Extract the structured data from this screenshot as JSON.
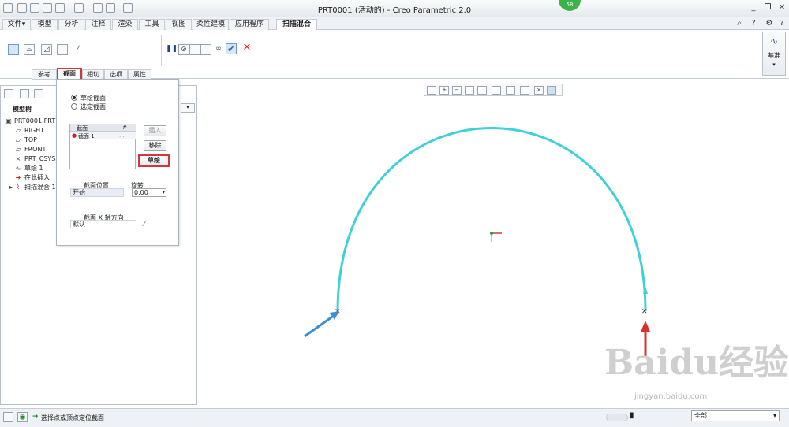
{
  "window": {
    "title": "PRT0001 (活动的) - Creo Parametric 2.0",
    "badge": "58"
  },
  "menu": {
    "tabs": [
      "文件▾",
      "模型",
      "分析",
      "注释",
      "渲染",
      "工具",
      "视图",
      "柔性建模",
      "应用程序"
    ],
    "active_tab": "扫描混合"
  },
  "ribbon": {
    "subtabs": [
      "参考",
      "截面",
      "相切",
      "选项",
      "属性"
    ],
    "active_subtab": "截面",
    "datum_label": "基准"
  },
  "section_panel": {
    "radio_sketched": "草绘截面",
    "radio_selected": "选定截面",
    "table_headers": [
      "截面",
      "#"
    ],
    "table_rows": [
      {
        "name": "截面 1",
        "num": "..."
      }
    ],
    "insert_btn": "插入",
    "remove_btn": "移除",
    "sketch_btn": "草绘",
    "location_label": "截面位置",
    "location_value": "开始",
    "rotation_label": "旋转",
    "rotation_value": "0.00",
    "xaxis_label": "截面 X 轴方向",
    "xaxis_value": "默认"
  },
  "model_tree": {
    "header": "模型树",
    "items": [
      "PRT0001.PRT",
      "RIGHT",
      "TOP",
      "FRONT",
      "PRT_CSYS_D",
      "草绘 1",
      "在此插入",
      "扫描混合 1"
    ]
  },
  "statusbar": {
    "message": "选择点或顶点定位截面",
    "filter_value": "全部"
  },
  "watermark": {
    "brand": "Baidu经验",
    "url": "jingyan.baidu.com"
  },
  "colors": {
    "curve": "#3fd0d8",
    "arrow_blue": "#3a8fd4",
    "arrow_red": "#d9302e",
    "highlight": "#d0383e"
  }
}
